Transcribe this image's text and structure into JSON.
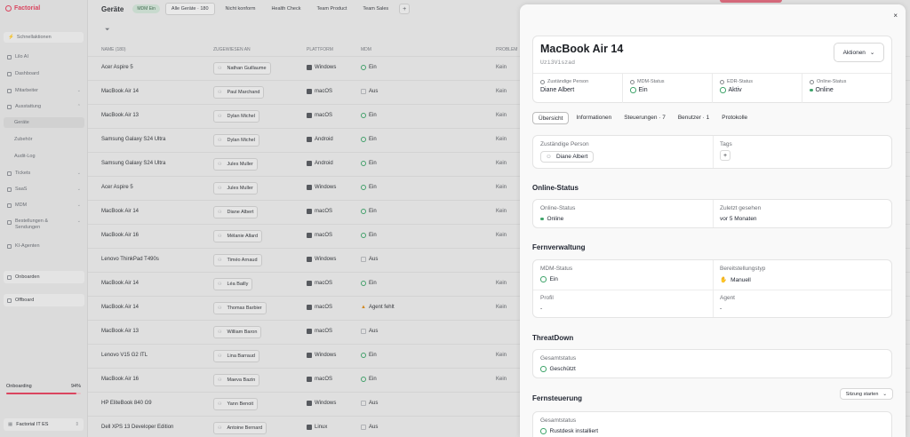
{
  "brand": "Factorial",
  "sidebar": {
    "quick_actions": "Schnellaktionen",
    "items": [
      {
        "label": "Lilo AI"
      },
      {
        "label": "Dashboard"
      },
      {
        "label": "Mitarbeiter"
      },
      {
        "label": "Ausstattung"
      },
      {
        "label": "Geräte"
      },
      {
        "label": "Zubehör"
      },
      {
        "label": "Audit-Log"
      },
      {
        "label": "Tickets"
      },
      {
        "label": "SaaS"
      },
      {
        "label": "MDM"
      },
      {
        "label": "Bestellungen & Sendungen"
      },
      {
        "label": "KI-Agenten"
      }
    ],
    "onboarden": "Onboarden",
    "offboard": "Offboard",
    "onboarding_label": "Onboarding",
    "onboarding_pct": "94%",
    "onboarding_fraction": 0.94,
    "company": "Factorial IT ES"
  },
  "toolbar": {
    "title": "Geräte",
    "mdm_badge": "MDM Ein",
    "tabs": [
      "Alle Geräte · 180",
      "Nicht konform",
      "Health Check",
      "Team Product",
      "Team Sales"
    ],
    "plus": "+"
  },
  "table": {
    "headers": [
      "NAME (180)",
      "ZUGEWIESEN AN",
      "PLATTFORM",
      "MDM",
      "PROBLEM"
    ],
    "rows": [
      {
        "name": "Acer Aspire 5",
        "person": "Nathan Guillaume",
        "platform": "Windows",
        "mdm": "Ein",
        "mdm_state": "on",
        "problem": "Kein"
      },
      {
        "name": "MacBook Air 14",
        "person": "Paul Marchand",
        "platform": "macOS",
        "mdm": "Aus",
        "mdm_state": "off",
        "problem": "Kein"
      },
      {
        "name": "MacBook Air 13",
        "person": "Dylan Michel",
        "platform": "macOS",
        "mdm": "Ein",
        "mdm_state": "on",
        "problem": "Kein"
      },
      {
        "name": "Samsung Galaxy S24 Ultra",
        "person": "Dylan Michel",
        "platform": "Android",
        "mdm": "Ein",
        "mdm_state": "on",
        "problem": "Kein"
      },
      {
        "name": "Samsung Galaxy S24 Ultra",
        "person": "Jules Muller",
        "platform": "Android",
        "mdm": "Ein",
        "mdm_state": "on",
        "problem": "Kein"
      },
      {
        "name": "Acer Aspire 5",
        "person": "Jules Muller",
        "platform": "Windows",
        "mdm": "Ein",
        "mdm_state": "on",
        "problem": "Kein"
      },
      {
        "name": "MacBook Air 14",
        "person": "Diane Albert",
        "platform": "macOS",
        "mdm": "Ein",
        "mdm_state": "on",
        "problem": "Kein"
      },
      {
        "name": "MacBook Air 16",
        "person": "Mélanie Allard",
        "platform": "macOS",
        "mdm": "Ein",
        "mdm_state": "on",
        "problem": "Kein"
      },
      {
        "name": "Lenovo ThinkPad T490s",
        "person": "Timéo Arnaud",
        "platform": "Windows",
        "mdm": "Aus",
        "mdm_state": "off",
        "problem": ""
      },
      {
        "name": "MacBook Air 14",
        "person": "Léa Bailly",
        "platform": "macOS",
        "mdm": "Ein",
        "mdm_state": "on",
        "problem": "Kein"
      },
      {
        "name": "MacBook Air 14",
        "person": "Thomas Barbier",
        "platform": "macOS",
        "mdm": "Agent fehlt",
        "mdm_state": "warn",
        "problem": "Kein"
      },
      {
        "name": "MacBook Air 13",
        "person": "William Baron",
        "platform": "macOS",
        "mdm": "Aus",
        "mdm_state": "off",
        "problem": ""
      },
      {
        "name": "Lenovo V15 G2 ITL",
        "person": "Lina Barraud",
        "platform": "Windows",
        "mdm": "Ein",
        "mdm_state": "on",
        "problem": "Kein"
      },
      {
        "name": "MacBook Air 16",
        "person": "Maeva Bazin",
        "platform": "macOS",
        "mdm": "Ein",
        "mdm_state": "on",
        "problem": "Kein"
      },
      {
        "name": "HP EliteBook 840 G9",
        "person": "Yann Benoit",
        "platform": "Windows",
        "mdm": "Aus",
        "mdm_state": "off",
        "problem": ""
      },
      {
        "name": "Dell XPS 13 Developer Edition",
        "person": "Antoine Bernard",
        "platform": "Linux",
        "mdm": "Aus",
        "mdm_state": "off",
        "problem": ""
      }
    ]
  },
  "panel": {
    "close": "×",
    "device_name": "MacBook Air 14",
    "serial": "Uzi3Viszad",
    "actions": "Aktionen",
    "stats": [
      {
        "label": "Zuständige Person",
        "value": "Diane Albert",
        "icon": "person-icon"
      },
      {
        "label": "MDM-Status",
        "value": "Ein",
        "icon": "check-circle-icon"
      },
      {
        "label": "EDR-Status",
        "value": "Aktiv",
        "icon": "check-circle-icon"
      },
      {
        "label": "Online-Status",
        "value": "Online",
        "icon": "online-dot"
      }
    ],
    "tabs": [
      "Übersicht",
      "Informationen",
      "Steuerungen · 7",
      "Benutzer · 1",
      "Protokolle"
    ],
    "assigned_label": "Zuständige Person",
    "assigned_value": "Diane Albert",
    "tags_label": "Tags",
    "tags_add": "+",
    "online_section": "Online-Status",
    "online_label": "Online-Status",
    "online_value": "Online",
    "last_seen_label": "Zuletzt gesehen",
    "last_seen_value": "vor 5 Monaten",
    "remote_section": "Fernverwaltung",
    "mdm_label": "MDM-Status",
    "mdm_value": "Ein",
    "provision_label": "Bereitstellungstyp",
    "provision_value": "Manuell",
    "profile_label": "Profil",
    "profile_value": "-",
    "agent_label": "Agent",
    "agent_value": "-",
    "threat_section": "ThreatDown",
    "threat_label": "Gesamtstatus",
    "threat_value": "Geschützt",
    "remote_control_section": "Fernsteuerung",
    "session_button": "Sitzung starten",
    "rc_label": "Gesamtstatus",
    "rc_value": "Rustdesk installiert"
  },
  "colors": {
    "brand": "#e3425e",
    "success": "#3ea46a",
    "warning": "#d98b1b"
  }
}
